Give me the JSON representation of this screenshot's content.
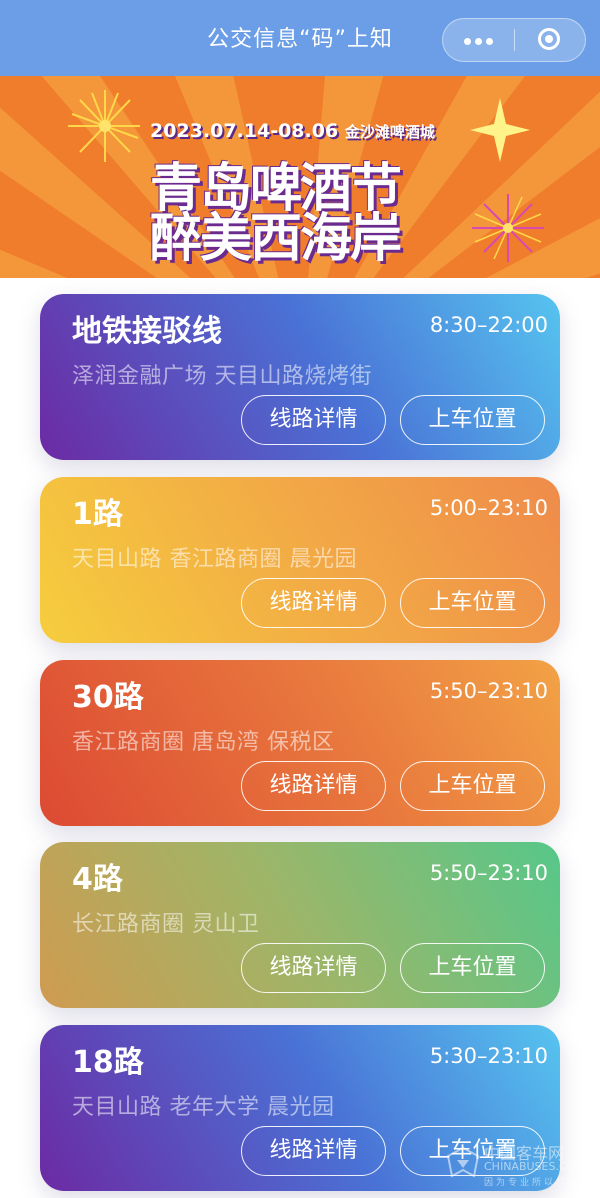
{
  "header": {
    "title": "公交信息“码”上知"
  },
  "banner": {
    "date_text": "2023.07.14-08.06",
    "venue": "金沙滩啤酒城",
    "line1": "青岛啤酒节",
    "line2": "醉美西海岸",
    "colors": {
      "background": "#f07d2b",
      "rays": "#f49a3a",
      "text_shadow": "#6a2a8e"
    }
  },
  "buttons": {
    "detail_label": "线路详情",
    "board_label": "上车位置"
  },
  "routes": [
    {
      "name": "地铁接驳线",
      "time": "8:30–22:00",
      "stops": "泽润金融广场 天目山路烧烤街"
    },
    {
      "name": "1路",
      "time": "5:00–23:10",
      "stops": "天目山路 香江路商圈 晨光园"
    },
    {
      "name": "30路",
      "time": "5:50–23:10",
      "stops": "香江路商圈 唐岛湾 保税区"
    },
    {
      "name": "4路",
      "time": "5:50–23:10",
      "stops": "长江路商圈 灵山卫"
    },
    {
      "name": "18路",
      "time": "5:30–23:10",
      "stops": "天目山路 老年大学 晨光园"
    }
  ],
  "watermark": {
    "line1": "中国客车网",
    "line2": "CHINABUSES.COM",
    "line3": "因为专业所以权威"
  }
}
